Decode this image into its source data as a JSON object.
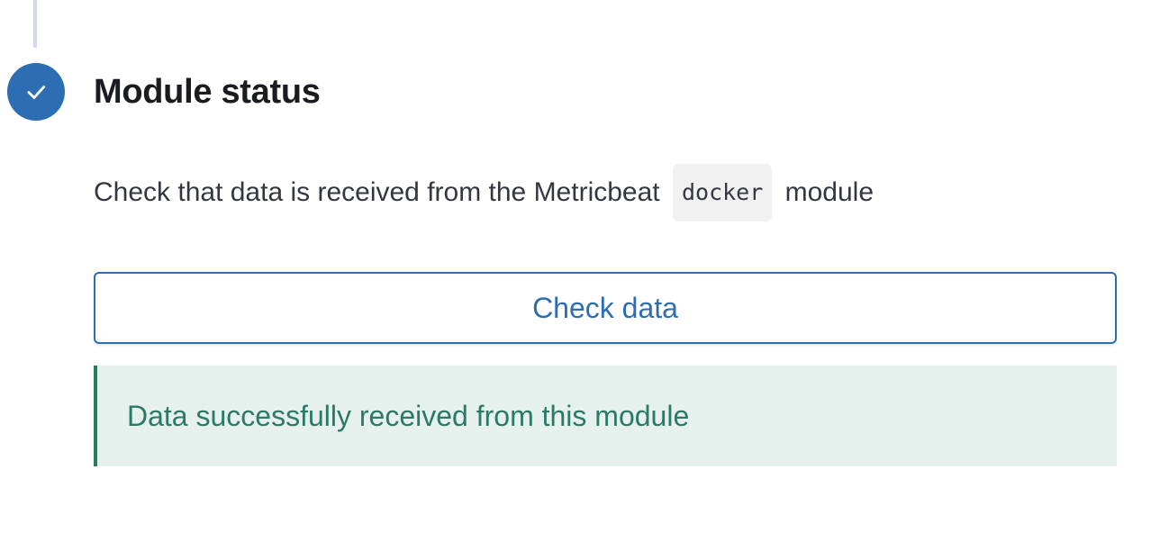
{
  "step": {
    "title": "Module status",
    "status": "complete",
    "status_icon": "check-icon",
    "accent_color": "#2d6db4"
  },
  "description": {
    "prefix": "Check that data is received from the Metricbeat",
    "code": "docker",
    "suffix": "module"
  },
  "actions": {
    "check_data_label": "Check data"
  },
  "callout": {
    "message": "Data successfully received from this module",
    "type": "success",
    "color": "#2b7a66"
  }
}
